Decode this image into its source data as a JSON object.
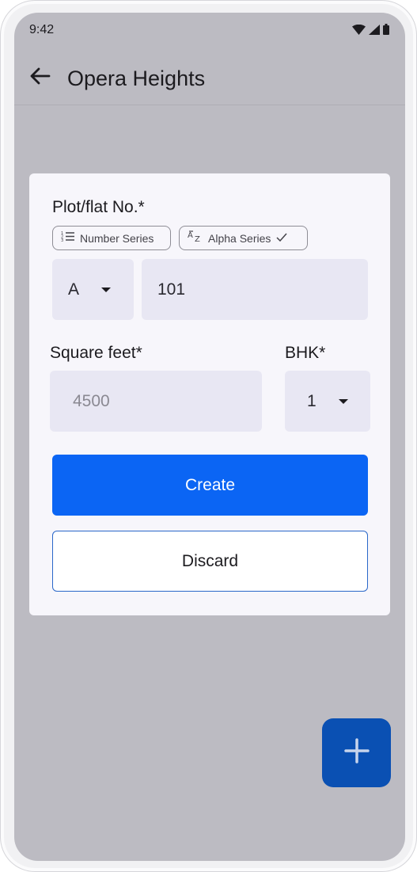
{
  "status_bar": {
    "time": "9:42",
    "icons": [
      "wifi-icon",
      "signal-icon",
      "battery-icon"
    ]
  },
  "app_bar": {
    "back_icon": "arrow-left-icon",
    "title": "Opera Heights"
  },
  "form": {
    "plot_label": "Plot/flat No.*",
    "series_chips": [
      {
        "label": "Number Series",
        "icon": "numbered-list-icon",
        "selected": false
      },
      {
        "label": "Alpha Series",
        "icon": "alpha-sort-icon",
        "selected": true
      }
    ],
    "block_select": {
      "value": "A"
    },
    "flat_number": {
      "value": "101"
    },
    "square_feet": {
      "label": "Square feet*",
      "placeholder": "4500"
    },
    "bhk": {
      "label": "BHK*",
      "value": "1"
    },
    "create_label": "Create",
    "discard_label": "Discard"
  },
  "fab": {
    "icon": "plus-icon"
  },
  "colors": {
    "primary": "#0b65f4",
    "fab": "#0a50b3",
    "scrim": "#bcbbc2",
    "field_bg": "#e8e7f3"
  }
}
